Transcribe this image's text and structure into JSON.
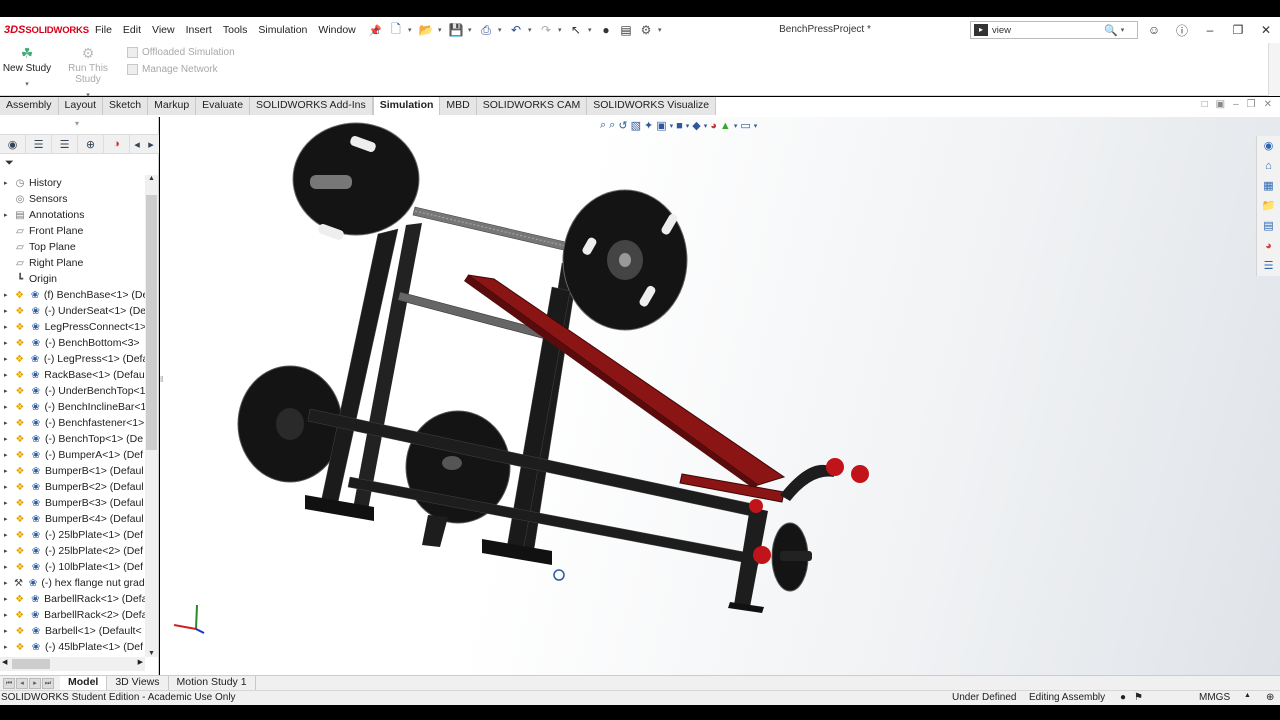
{
  "app": {
    "brand_mark": "3DS",
    "brand_name": "SOLIDWORKS",
    "document_title": "BenchPressProject *"
  },
  "menu": [
    "File",
    "Edit",
    "View",
    "Insert",
    "Tools",
    "Simulation",
    "Window"
  ],
  "search": {
    "value": "view"
  },
  "ribbon": {
    "new_study": "New Study",
    "run_study": "Run This Study",
    "offloaded_simulation": "Offloaded Simulation",
    "manage_network": "Manage Network"
  },
  "tabs": [
    "Assembly",
    "Layout",
    "Sketch",
    "Markup",
    "Evaluate",
    "SOLIDWORKS Add-Ins",
    "Simulation",
    "MBD",
    "SOLIDWORKS CAM",
    "SOLIDWORKS Visualize"
  ],
  "active_tab": "Simulation",
  "tree": [
    {
      "label": "History",
      "icon": "history-icon",
      "expandable": true
    },
    {
      "label": "Sensors",
      "icon": "sensors-icon",
      "expandable": false
    },
    {
      "label": "Annotations",
      "icon": "annotations-icon",
      "expandable": true
    },
    {
      "label": "Front Plane",
      "icon": "plane-icon",
      "expandable": false
    },
    {
      "label": "Top Plane",
      "icon": "plane-icon",
      "expandable": false
    },
    {
      "label": "Right Plane",
      "icon": "plane-icon",
      "expandable": false
    },
    {
      "label": "Origin",
      "icon": "origin-icon",
      "expandable": false
    },
    {
      "label": "(f) BenchBase<1> (De",
      "icon": "part-icon",
      "expandable": true
    },
    {
      "label": "(-) UnderSeat<1> (De",
      "icon": "part-icon",
      "expandable": true
    },
    {
      "label": "LegPressConnect<1>",
      "icon": "part-icon",
      "expandable": true
    },
    {
      "label": "(-) BenchBottom<3>",
      "icon": "part-icon",
      "expandable": true
    },
    {
      "label": "(-) LegPress<1> (Defa",
      "icon": "part-icon",
      "expandable": true
    },
    {
      "label": "RackBase<1> (Defaul",
      "icon": "part-icon",
      "expandable": true
    },
    {
      "label": "(-) UnderBenchTop<1",
      "icon": "part-icon",
      "expandable": true
    },
    {
      "label": "(-) BenchInclineBar<1",
      "icon": "part-icon",
      "expandable": true
    },
    {
      "label": "(-) Benchfastener<1>",
      "icon": "part-icon",
      "expandable": true
    },
    {
      "label": "(-) BenchTop<1> (De",
      "icon": "part-icon",
      "expandable": true
    },
    {
      "label": "(-) BumperA<1> (Def",
      "icon": "part-icon",
      "expandable": true
    },
    {
      "label": "BumperB<1> (Defaul",
      "icon": "part-icon",
      "expandable": true
    },
    {
      "label": "BumperB<2> (Defaul",
      "icon": "part-icon",
      "expandable": true
    },
    {
      "label": "BumperB<3> (Defaul",
      "icon": "part-icon",
      "expandable": true
    },
    {
      "label": "BumperB<4> (Defaul",
      "icon": "part-icon",
      "expandable": true
    },
    {
      "label": "(-) 25lbPlate<1> (Def",
      "icon": "part-icon",
      "expandable": true
    },
    {
      "label": "(-) 25lbPlate<2> (Def",
      "icon": "part-icon",
      "expandable": true
    },
    {
      "label": "(-) 10lbPlate<1> (Def",
      "icon": "part-icon",
      "expandable": true
    },
    {
      "label": "(-) hex flange nut gradea",
      "icon": "toolbox-icon",
      "expandable": true
    },
    {
      "label": "BarbellRack<1> (Defa",
      "icon": "part-icon",
      "expandable": true
    },
    {
      "label": "BarbellRack<2> (Defa",
      "icon": "part-icon",
      "expandable": true
    },
    {
      "label": "Barbell<1> (Default<",
      "icon": "part-icon",
      "expandable": true
    },
    {
      "label": "(-) 45lbPlate<1> (Def",
      "icon": "part-icon",
      "expandable": true
    }
  ],
  "bottom_tabs": [
    "Model",
    "3D Views",
    "Motion Study 1"
  ],
  "status": {
    "edition": "SOLIDWORKS Student Edition - Academic Use Only",
    "definition": "Under Defined",
    "mode": "Editing Assembly",
    "units": "MMGS"
  },
  "colors": {
    "bench_red": "#8b1414",
    "frame_black": "#1a1a1a",
    "brand_red": "#d6001c"
  }
}
